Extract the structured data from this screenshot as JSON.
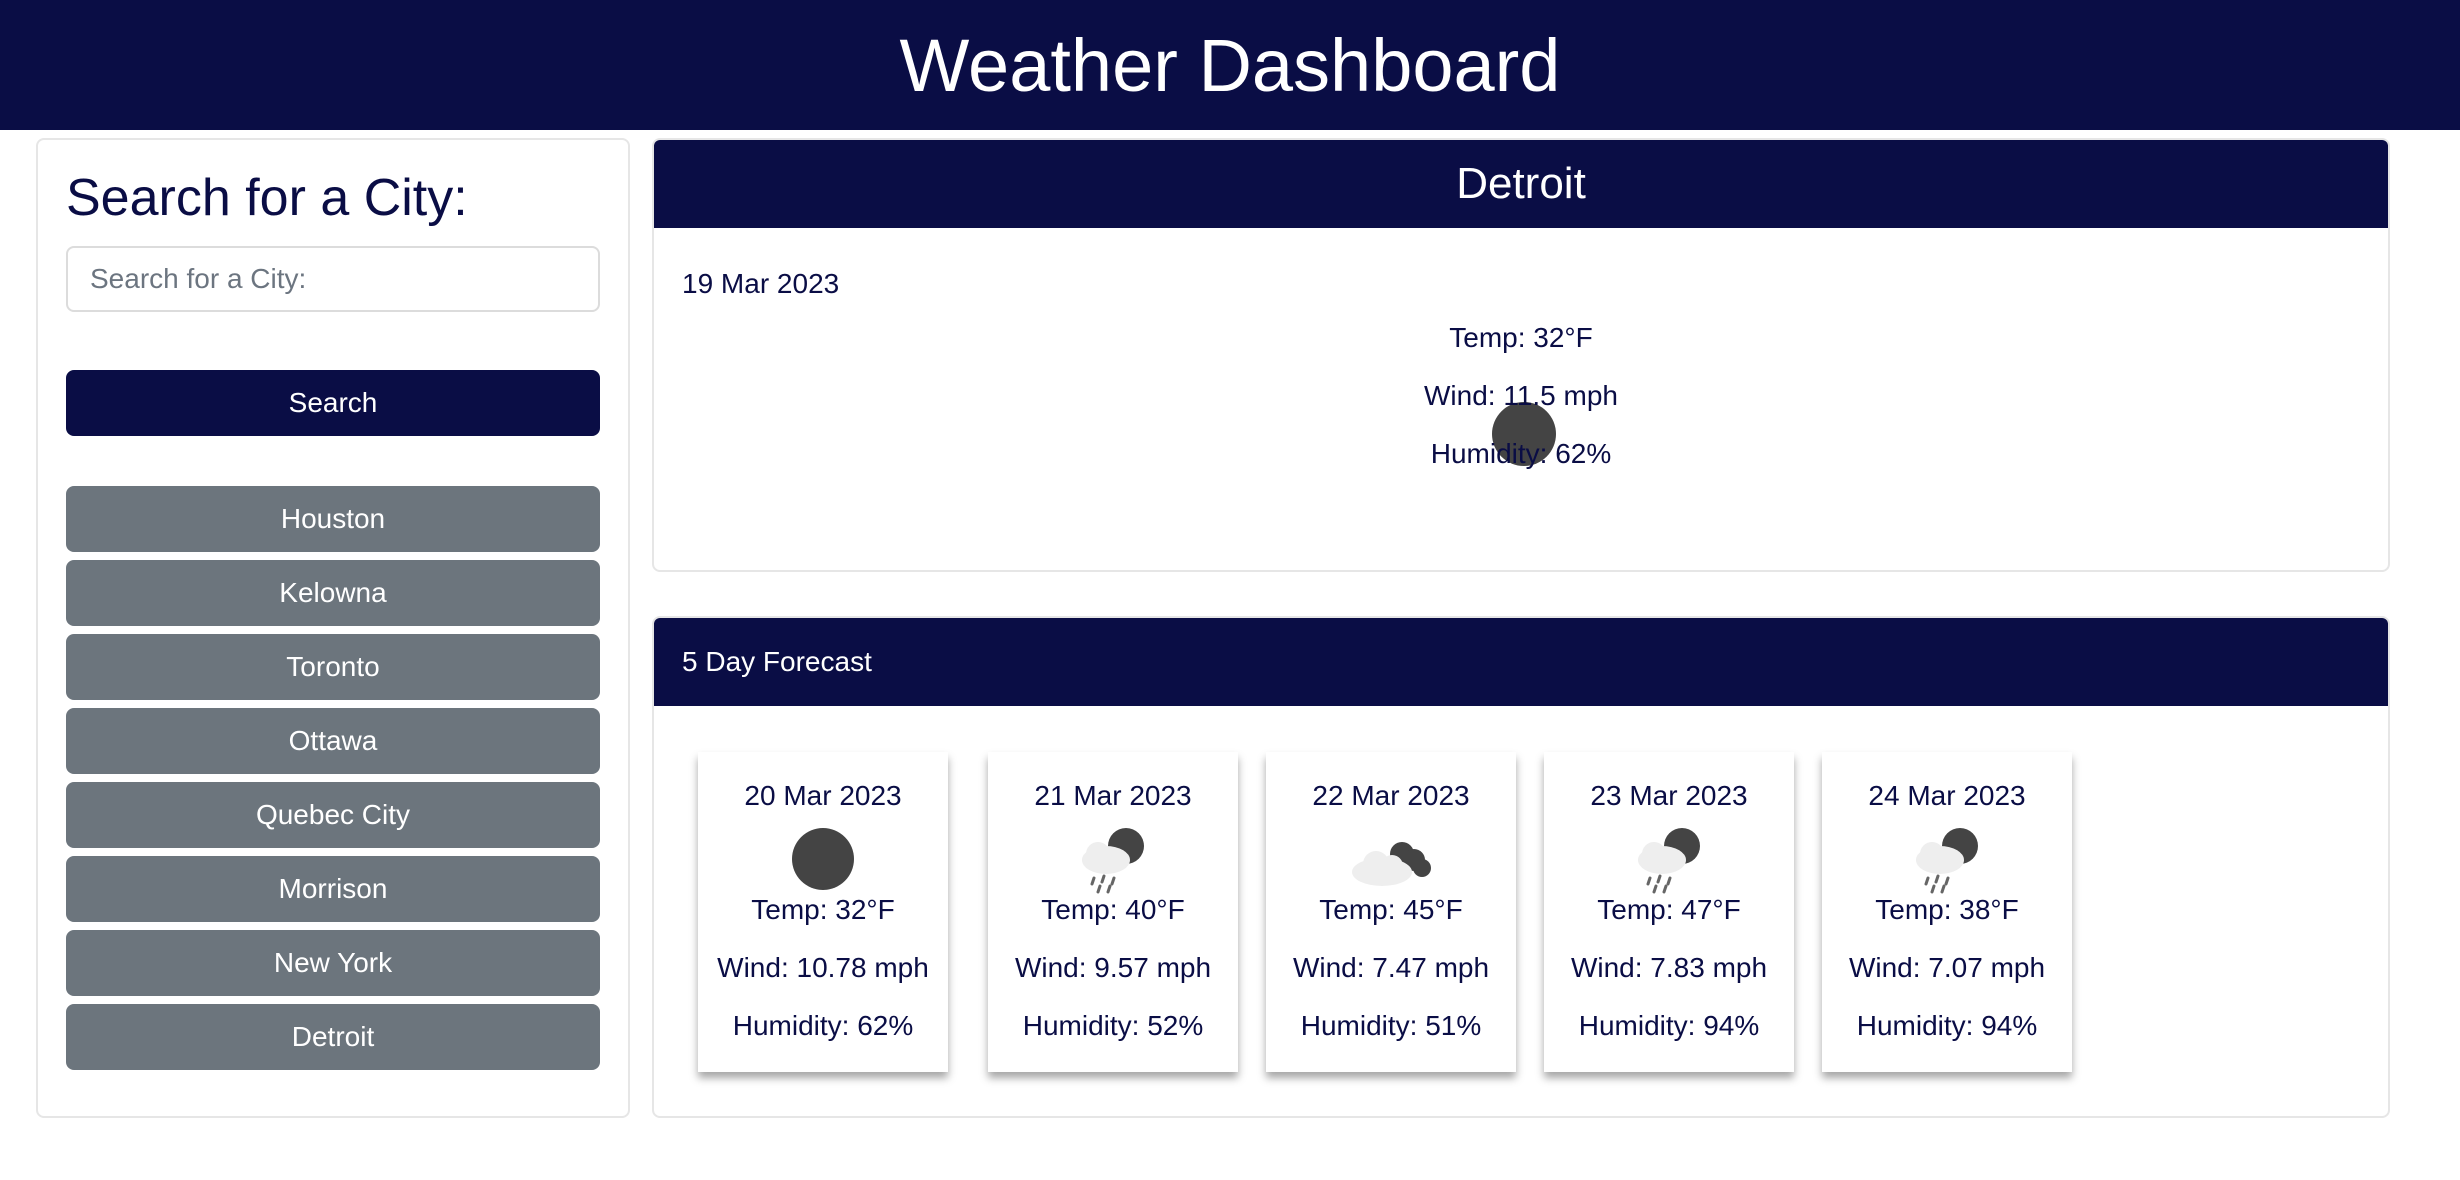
{
  "header": {
    "title": "Weather Dashboard"
  },
  "sidebar": {
    "title": "Search for a City:",
    "search_placeholder": "Search for a City:",
    "search_button": "Search",
    "cities": [
      "Houston",
      "Kelowna",
      "Toronto",
      "Ottawa",
      "Quebec City",
      "Morrison",
      "New York",
      "Detroit"
    ]
  },
  "current": {
    "city": "Detroit",
    "date": "19 Mar 2023",
    "icon": "moon-icon",
    "temp": "Temp: 32°F",
    "wind": "Wind: 11.5 mph",
    "humidity": "Humidity: 62%"
  },
  "forecast": {
    "title": "5 Day Forecast",
    "days": [
      {
        "date": "20 Mar 2023",
        "icon": "moon-icon",
        "temp": "Temp: 32°F",
        "wind": "Wind: 10.78 mph",
        "humidity": "Humidity: 62%"
      },
      {
        "date": "21 Mar 2023",
        "icon": "night-rain-icon",
        "temp": "Temp: 40°F",
        "wind": "Wind: 9.57 mph",
        "humidity": "Humidity: 52%"
      },
      {
        "date": "22 Mar 2023",
        "icon": "broken-clouds-icon",
        "temp": "Temp: 45°F",
        "wind": "Wind: 7.47 mph",
        "humidity": "Humidity: 51%"
      },
      {
        "date": "23 Mar 2023",
        "icon": "night-rain-icon",
        "temp": "Temp: 47°F",
        "wind": "Wind: 7.83 mph",
        "humidity": "Humidity: 94%"
      },
      {
        "date": "24 Mar 2023",
        "icon": "night-rain-icon",
        "temp": "Temp: 38°F",
        "wind": "Wind: 7.07 mph",
        "humidity": "Humidity: 94%"
      }
    ]
  },
  "colors": {
    "primary": "#0a0d45",
    "secondary": "#6c757d",
    "border": "#e6e6e6"
  }
}
